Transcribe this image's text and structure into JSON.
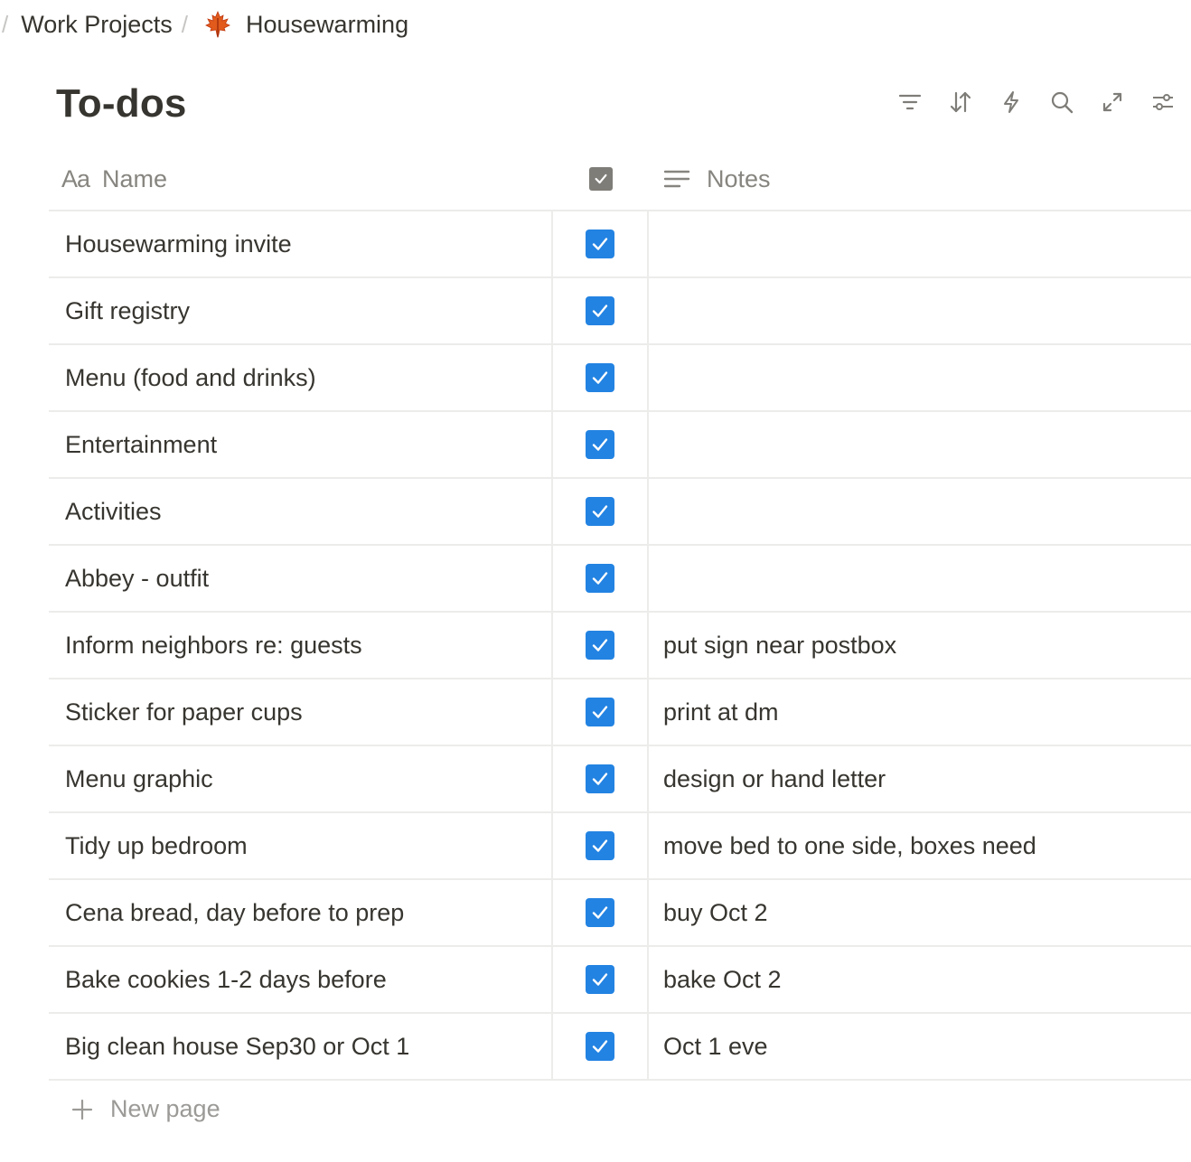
{
  "breadcrumb": {
    "separator": "/",
    "parent": "Work Projects",
    "current": "Housewarming",
    "current_icon": "maple-leaf-icon"
  },
  "page": {
    "title": "To-dos"
  },
  "toolbar": {
    "icons": [
      "filter-icon",
      "sort-icon",
      "automation-bolt-icon",
      "search-icon",
      "expand-icon",
      "settings-sliders-icon"
    ]
  },
  "table": {
    "columns": {
      "name": "Name",
      "name_icon": "Aa",
      "done_icon": "checkbox-icon",
      "notes": "Notes"
    },
    "rows": [
      {
        "name": "Housewarming invite",
        "done": true,
        "notes": ""
      },
      {
        "name": "Gift registry",
        "done": true,
        "notes": ""
      },
      {
        "name": "Menu (food and drinks)",
        "done": true,
        "notes": ""
      },
      {
        "name": "Entertainment",
        "done": true,
        "notes": ""
      },
      {
        "name": "Activities",
        "done": true,
        "notes": ""
      },
      {
        "name": "Abbey - outfit",
        "done": true,
        "notes": ""
      },
      {
        "name": "Inform neighbors re: guests",
        "done": true,
        "notes": "put sign near postbox"
      },
      {
        "name": "Sticker for paper cups",
        "done": true,
        "notes": "print at dm"
      },
      {
        "name": "Menu graphic",
        "done": true,
        "notes": "design or hand letter"
      },
      {
        "name": "Tidy up bedroom",
        "done": true,
        "notes": "move bed to one side, boxes need"
      },
      {
        "name": "Cena bread, day before to prep",
        "done": true,
        "notes": "buy Oct 2"
      },
      {
        "name": "Bake cookies 1-2 days before",
        "done": true,
        "notes": "bake Oct 2"
      },
      {
        "name": "Big clean house Sep30 or Oct 1",
        "done": true,
        "notes": "Oct 1 eve"
      }
    ]
  },
  "footer": {
    "new_page_label": "New page"
  },
  "colors": {
    "accent": "#2383e2",
    "text": "#37352f",
    "muted": "#87857f",
    "border": "#ececeb"
  }
}
